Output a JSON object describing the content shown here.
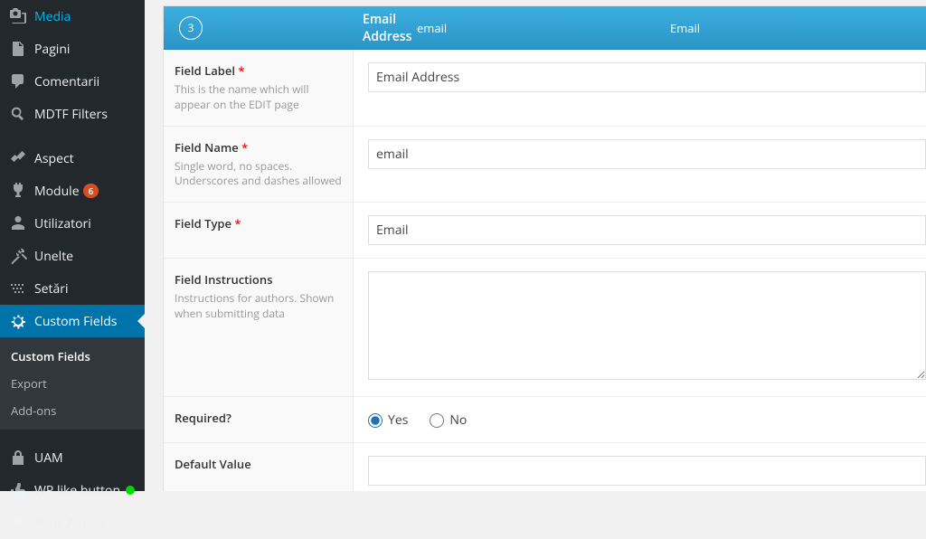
{
  "sidebar": {
    "items": [
      {
        "label": "Media"
      },
      {
        "label": "Pagini"
      },
      {
        "label": "Comentarii"
      },
      {
        "label": "MDTF Filters"
      },
      {
        "label": "Aspect"
      },
      {
        "label": "Module",
        "badge": "6"
      },
      {
        "label": "Utilizatori"
      },
      {
        "label": "Unelte"
      },
      {
        "label": "Setări"
      },
      {
        "label": "Custom Fields"
      },
      {
        "label": "UAM"
      },
      {
        "label": "WP like button"
      },
      {
        "label": "Pods Admin"
      }
    ],
    "submenu": [
      {
        "label": "Custom Fields"
      },
      {
        "label": "Export"
      },
      {
        "label": "Add-ons"
      }
    ]
  },
  "header": {
    "order": "3",
    "label": "Email Address",
    "name": "email",
    "type": "Email"
  },
  "rows": {
    "field_label": {
      "title": "Field Label",
      "desc": "This is the name which will appear on the EDIT page",
      "value": "Email Address"
    },
    "field_name": {
      "title": "Field Name",
      "desc": "Single word, no spaces. Underscores and dashes allowed",
      "value": "email"
    },
    "field_type": {
      "title": "Field Type",
      "value": "Email"
    },
    "field_instructions": {
      "title": "Field Instructions",
      "desc": "Instructions for authors. Shown when submitting data",
      "value": ""
    },
    "required": {
      "title": "Required?",
      "yes": "Yes",
      "no": "No"
    },
    "default_value": {
      "title": "Default Value"
    }
  }
}
